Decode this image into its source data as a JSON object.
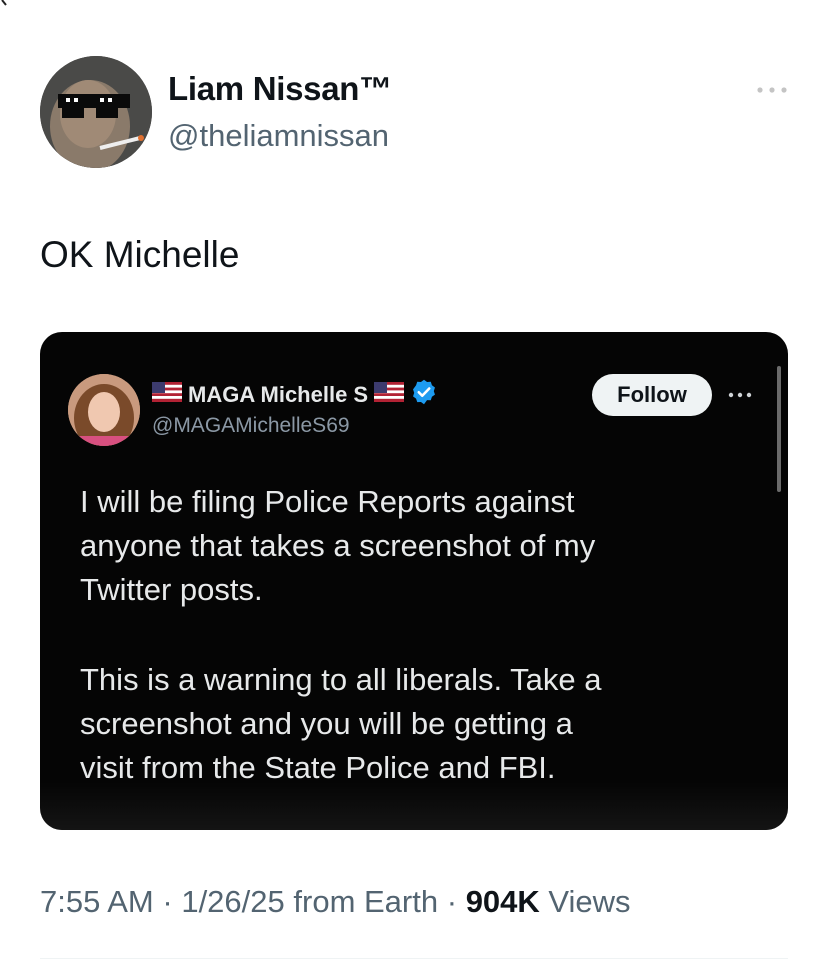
{
  "author": {
    "display_name": "Liam Nissan™",
    "handle": "@theliamnissan"
  },
  "tweet": {
    "text": "OK Michelle"
  },
  "embedded_post": {
    "author_name": "MAGA Michelle S",
    "author_handle": "@MAGAMichelleS69",
    "follow_label": "Follow",
    "paragraph_1": "I will be filing Police Reports against\nanyone that takes a screenshot of my\nTwitter posts.",
    "paragraph_2": "This is a warning to all liberals. Take a\nscreenshot and you will be getting a\nvisit from the State Police and FBI."
  },
  "meta": {
    "time": "7:55 AM",
    "separator": "·",
    "date": "1/26/25",
    "source": "from Earth",
    "views_count": "904K",
    "views_label": "Views"
  },
  "colors": {
    "secondary_text": "#536471",
    "verified_badge": "#1d9bf0",
    "card_background": "#050505"
  }
}
